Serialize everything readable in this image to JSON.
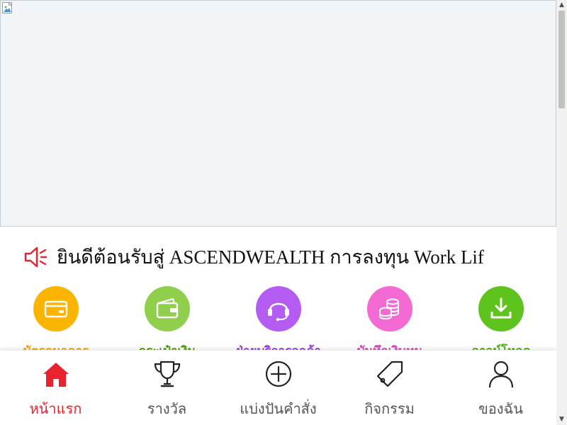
{
  "marquee": {
    "text": "ยินดีต้อนรับสู่ ASCENDWEALTH การลงทุน Work Lif",
    "icon": "speaker-icon"
  },
  "features": [
    {
      "label": "บัตรธนาคาร",
      "icon": "card-icon",
      "color": "#fbb500",
      "label_color": "#f0a800"
    },
    {
      "label": "กระเป๋าเงิน",
      "icon": "wallet-icon",
      "color": "#8fcf4b",
      "label_color": "#4aa000"
    },
    {
      "label": "ฝ่ายบริการลูกค้า",
      "icon": "headset-icon",
      "color": "#b45cf2",
      "label_color": "#9a3fe0"
    },
    {
      "label": "บันทึกเงินทุน",
      "icon": "coins-icon",
      "color": "#f26ad2",
      "label_color": "#e040c0"
    },
    {
      "label": "ดาวน์โหลด",
      "icon": "download-icon",
      "color": "#5ec41d",
      "label_color": "#4bb010"
    }
  ],
  "nav": {
    "items": [
      {
        "label": "หน้าแรก",
        "icon": "home-icon"
      },
      {
        "label": "รางวัล",
        "icon": "trophy-icon"
      },
      {
        "label": "แบ่งปันคำสั่ง",
        "icon": "plus-circle-icon"
      },
      {
        "label": "กิจกรรม",
        "icon": "tag-icon"
      },
      {
        "label": "ของฉัน",
        "icon": "user-icon"
      }
    ],
    "active_color": "#e8232d"
  }
}
